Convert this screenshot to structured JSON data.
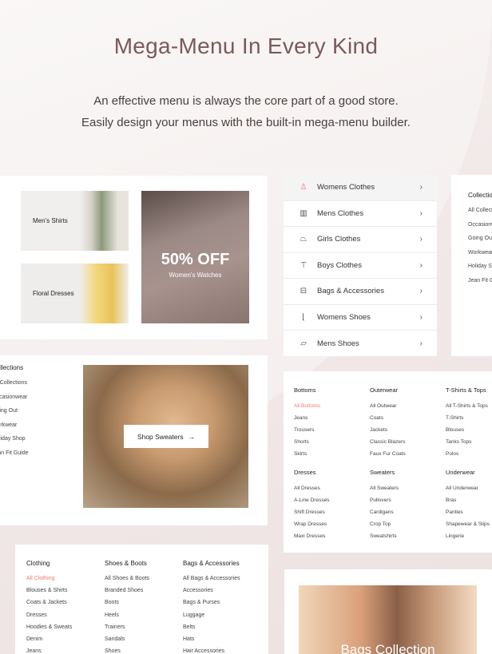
{
  "header": {
    "title": "Mega-Menu In Every Kind",
    "subtitle_line1": "An effective menu is always the core part of a good store.",
    "subtitle_line2": "Easily design your menus with the built-in mega-menu builder."
  },
  "colors": {
    "title": "#7a5a5a",
    "accent": "#f07b6d"
  },
  "promo_card": {
    "mens_shirts": "Men's Shirts",
    "floral_dresses": "Floral Dresses",
    "discount": "50% OFF",
    "discount_sub": "Women's Watches"
  },
  "collections_card": {
    "heading": "Collections",
    "items": [
      "All Collections",
      "Occasionwear",
      "Going Out",
      "Workwear",
      "Holiday Shop",
      "Jean Fit Guide"
    ],
    "button": "Shop Sweaters",
    "button_icon": "arrow-right-icon"
  },
  "category_menu": [
    {
      "label": "Womens Clothes",
      "icon": "dress-icon",
      "active": true
    },
    {
      "label": "Mens Clothes",
      "icon": "jacket-icon"
    },
    {
      "label": "Girls Clothes",
      "icon": "skirt-icon"
    },
    {
      "label": "Boys Clothes",
      "icon": "tshirt-icon"
    },
    {
      "label": "Bags & Accessories",
      "icon": "bag-icon"
    },
    {
      "label": "Womens Shoes",
      "icon": "heel-icon"
    },
    {
      "label": "Mens Shoes",
      "icon": "shoe-icon"
    }
  ],
  "right_collections": {
    "heading": "Collections",
    "items": [
      "All Collections",
      "Occasionwear",
      "Going Out",
      "Workwear",
      "Holiday Shop",
      "Jean Fit Guide"
    ]
  },
  "mega_menu": [
    {
      "heading": "Bottoms",
      "items": [
        "All Bottoms",
        "Jeans",
        "Trousers",
        "Shorts",
        "Skirts"
      ]
    },
    {
      "heading": "Outerwear",
      "items": [
        "All Outwear",
        "Coats",
        "Jackets",
        "Classic Blazers",
        "Faux Fur Coats"
      ]
    },
    {
      "heading": "T-Shirts & Tops",
      "items": [
        "All T-Shirts & Tops",
        "T-Shirts",
        "Blouses",
        "Tanks Tops",
        "Polos"
      ]
    },
    {
      "heading": "Dresses",
      "items": [
        "All Dresses",
        "A-Line Dresses",
        "Shift Dresses",
        "Wrap Dresses",
        "Maxi Dresses"
      ]
    },
    {
      "heading": "Sweaters",
      "items": [
        "All Sweaters",
        "Pullovers",
        "Cardigans",
        "Crop Top",
        "Sweatshirts"
      ]
    },
    {
      "heading": "Underwear",
      "items": [
        "All Underwear",
        "Bras",
        "Panties",
        "Shapewear & Slips",
        "Lingerie"
      ]
    }
  ],
  "bottom_menu": [
    {
      "heading": "Clothing",
      "items": [
        "All Clothing",
        "Blouses & Shirts",
        "Coats & Jackets",
        "Dresses",
        "Hoodies & Sweats",
        "Denim",
        "Jeans"
      ]
    },
    {
      "heading": "Shoes & Boots",
      "items": [
        "All Shoes & Boots",
        "Branded Shoes",
        "Boots",
        "Heels",
        "Trainers",
        "Sandals",
        "Shoes"
      ]
    },
    {
      "heading": "Bags & Accessories",
      "items": [
        "All Bags & Accessories",
        "Accessories",
        "Bags & Purses",
        "Luggage",
        "Belts",
        "Hats",
        "Hair Accessories"
      ]
    }
  ],
  "bags_card": {
    "title": "Bags Collection"
  }
}
